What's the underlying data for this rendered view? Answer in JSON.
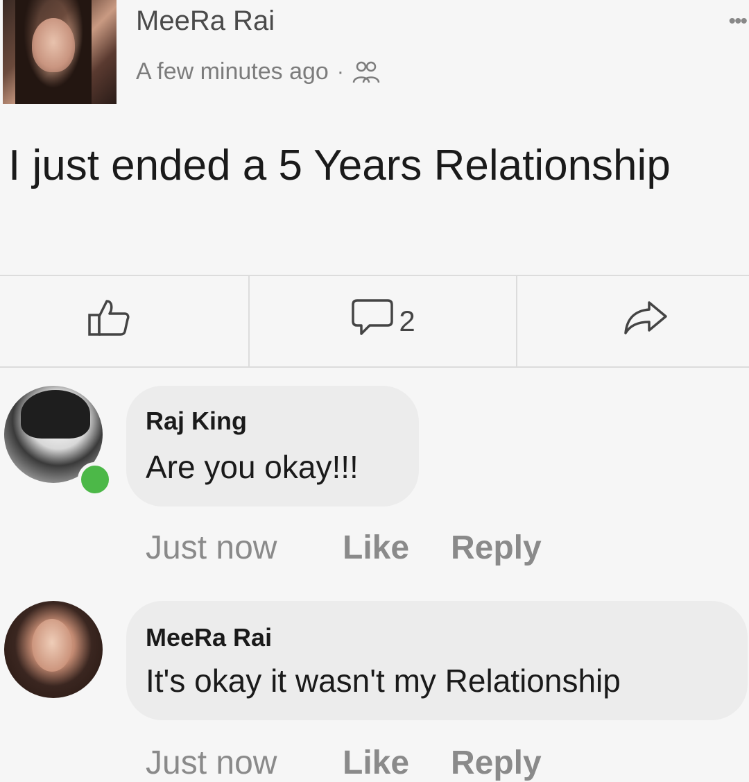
{
  "post": {
    "author": "MeeRa Rai",
    "time": "A few minutes ago",
    "separator": "·",
    "privacy_icon": "friends-icon",
    "more": "•••",
    "text": "I just ended a 5 Years Relationship",
    "comment_count": "2"
  },
  "comments": [
    {
      "author": "Raj King",
      "text": "Are you okay!!!",
      "time": "Just now",
      "like": "Like",
      "reply": "Reply"
    },
    {
      "author": "MeeRa Rai",
      "text": "It's okay it wasn't my Relationship",
      "time": "Just now",
      "like": "Like",
      "reply": "Reply"
    }
  ],
  "colors": {
    "online": "#4cb848",
    "bubble": "#ececec"
  }
}
